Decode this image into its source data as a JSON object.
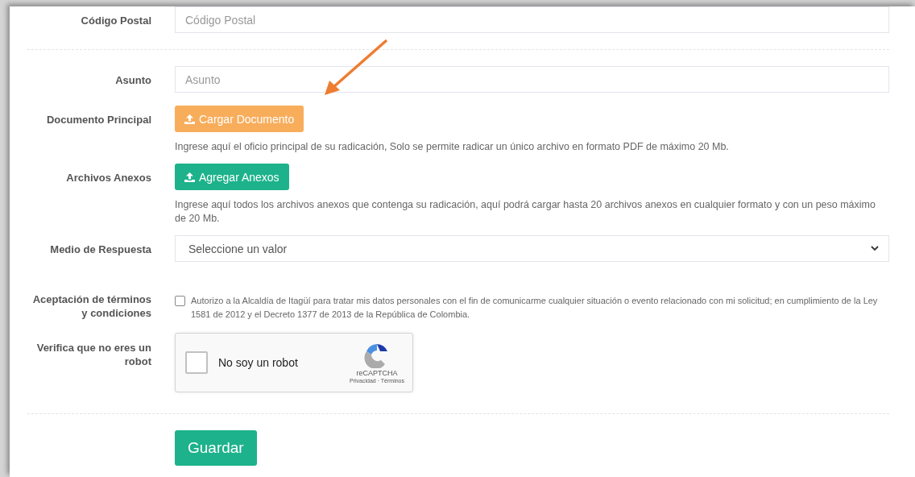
{
  "form": {
    "rows": [
      {
        "kind": "input",
        "label": "Código Postal",
        "placeholder": "Código Postal"
      },
      {
        "kind": "divider"
      },
      {
        "kind": "input",
        "label": "Asunto",
        "placeholder": "Asunto"
      },
      {
        "kind": "upload",
        "label": "Documento Principal",
        "button": "Cargar Documento",
        "color": "#f8ad5b",
        "help": "Ingrese aquí el oficio principal de su radicación, Solo se permite radicar un único archivo en formato PDF de máximo 20 Mb."
      },
      {
        "kind": "upload",
        "label": "Archivos Anexos",
        "button": "Agregar Anexos",
        "color": "#1db28b",
        "help": "Ingrese aquí todos los archivos anexos que contenga su radicación, aquí podrá cargar hasta 20 archivos anexos en cualquier formato y con un peso máximo de 20 Mb."
      },
      {
        "kind": "select",
        "label": "Medio de Respuesta",
        "value": "Seleccione un valor"
      },
      {
        "kind": "checkbox",
        "label": "Aceptación de términos y condiciones",
        "text": "Autorizo a la Alcaldía de Itagüí para tratar mis datos personales con el fin de comunicarme cualquier situación o evento relacionado con mi solicitud; en cumplimiento de la Ley 1581 de 2012 y el Decreto 1377 de 2013 de la República de Colombia.",
        "checked": false
      },
      {
        "kind": "captcha",
        "label": "Verifica que no eres un robot",
        "text": "No soy un robot",
        "brand": "reCAPTCHA",
        "links": "Privacidad · Términos",
        "checked": false
      },
      {
        "kind": "divider"
      },
      {
        "kind": "submit",
        "button": "Guardar",
        "color": "#1db28b"
      }
    ]
  },
  "annotation": {
    "kind": "arrow"
  }
}
